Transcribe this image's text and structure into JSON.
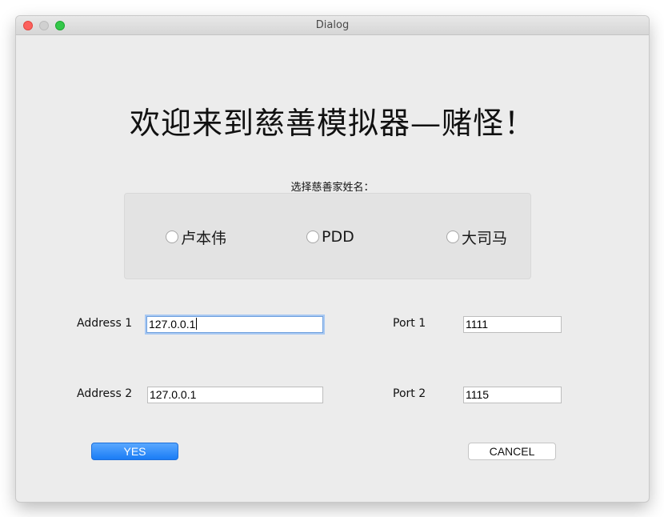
{
  "window": {
    "title": "Dialog"
  },
  "header": {
    "welcome": "欢迎来到慈善模拟器—赌怪！"
  },
  "selection": {
    "label": "选择慈善家姓名：",
    "options": [
      "卢本伟",
      "PDD",
      "大司马"
    ]
  },
  "connection": {
    "address1": {
      "label": "Address 1",
      "value": "127.0.0.1"
    },
    "port1": {
      "label": "Port 1",
      "value": "1111"
    },
    "address2": {
      "label": "Address 2",
      "value": "127.0.0.1"
    },
    "port2": {
      "label": "Port 2",
      "value": "1115"
    }
  },
  "buttons": {
    "yes": "YES",
    "cancel": "CANCEL"
  },
  "colors": {
    "primary_button": "#1a7cf5",
    "focus_ring": "#a8c8f2",
    "window_bg": "#ececec"
  }
}
